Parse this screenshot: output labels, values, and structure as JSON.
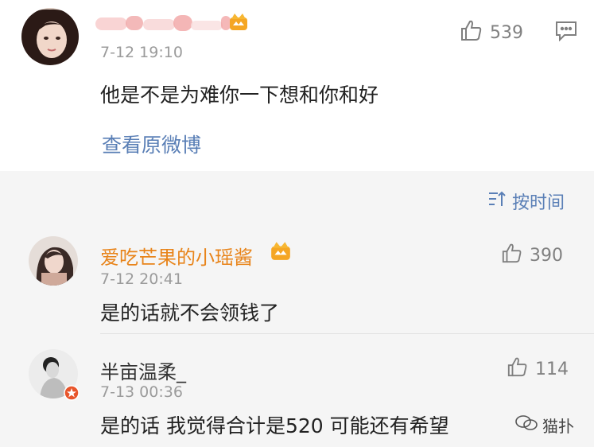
{
  "top_comment": {
    "time": "7-12 19:10",
    "likes": "539",
    "text": "他是不是为难你一下想和你和好",
    "view_original": "查看原微博"
  },
  "sort": {
    "label": "按时间"
  },
  "replies": [
    {
      "name": "爱吃芒果的小瑶酱",
      "time": "7-12 20:41",
      "likes": "390",
      "text": "是的话就不会领钱了"
    },
    {
      "name": "半亩温柔_",
      "time": "7-13 00:36",
      "likes": "114",
      "text": "是的话 我觉得合计是520 可能还有希望"
    }
  ],
  "watermark": {
    "text": "猫扑"
  },
  "colors": {
    "link": "#5a7fb6",
    "reply_name_orange": "#e8841a",
    "badge_gold": "#f5a623"
  },
  "icons": [
    "thumb-up-icon",
    "comment-icon",
    "sort-icon",
    "crown-badge-icon",
    "verified-badge-icon"
  ]
}
